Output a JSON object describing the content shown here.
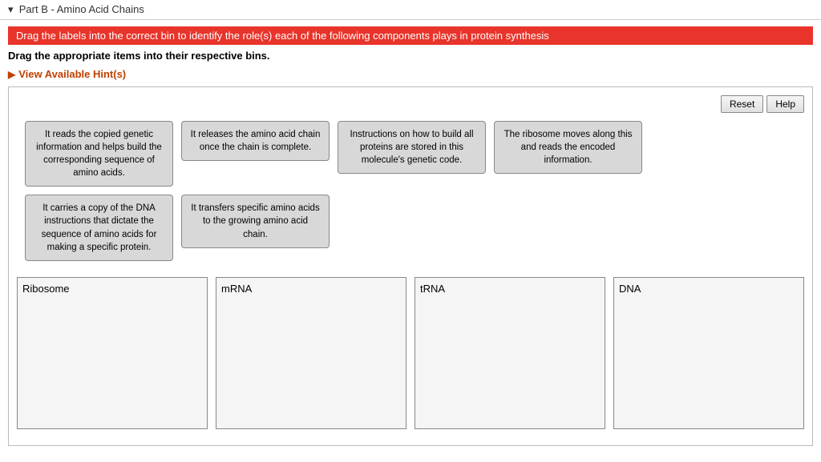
{
  "header": {
    "title": "Part B - Amino Acid Chains"
  },
  "instruction_banner": "Drag the labels into the correct bin to identify the role(s) each of the following components plays in protein synthesis",
  "drag_instruction": "Drag the appropriate items into their respective bins.",
  "hint_link": "View Available Hint(s)",
  "buttons": {
    "reset": "Reset",
    "help": "Help"
  },
  "label_cards": [
    "It reads the copied genetic information and helps build the corresponding sequence of amino acids.",
    "It releases the amino acid chain once the chain is complete.",
    "Instructions on how to build all proteins are stored in this molecule's genetic code.",
    "The ribosome moves along this and reads the encoded information.",
    "It carries a copy of the DNA instructions that dictate the sequence of amino acids for making a specific protein.",
    "It transfers specific amino acids to the growing amino acid chain."
  ],
  "bins": [
    {
      "label": "Ribosome"
    },
    {
      "label": "mRNA"
    },
    {
      "label": "tRNA"
    },
    {
      "label": "DNA"
    }
  ]
}
